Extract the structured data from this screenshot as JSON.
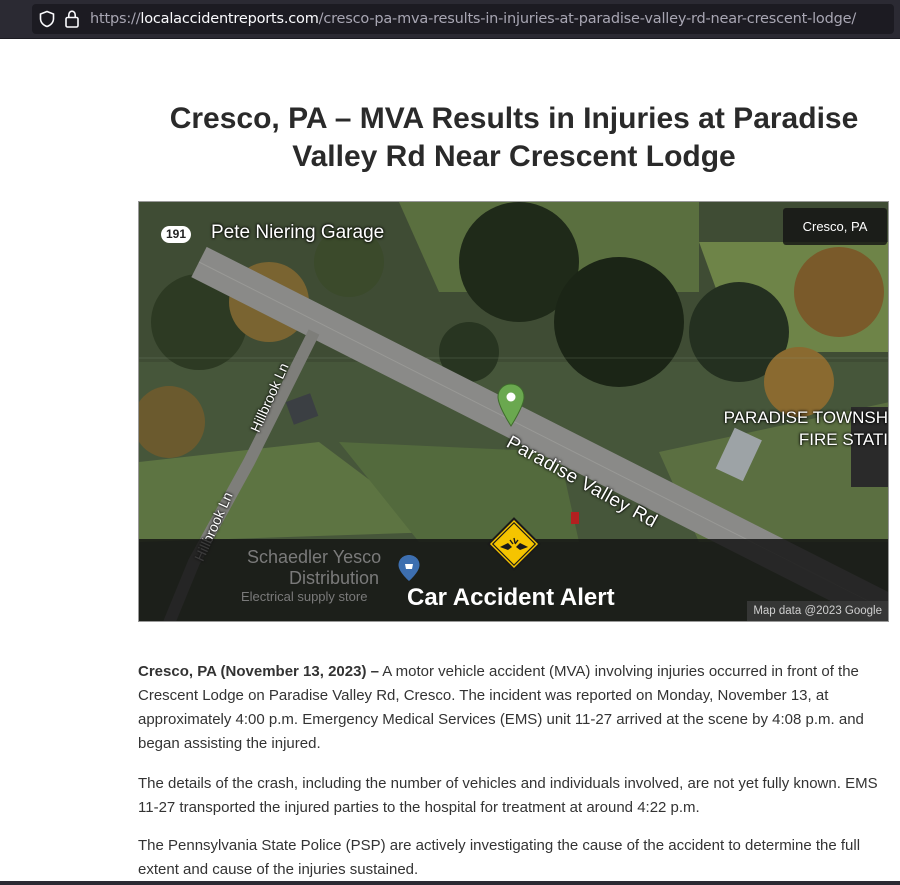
{
  "browser": {
    "url_protocol": "https://",
    "url_host": "localaccidentreports.com",
    "url_path": "/cresco-pa-mva-results-in-injuries-at-paradise-valley-rd-near-crescent-lodge/"
  },
  "article": {
    "title": "Cresco, PA – MVA Results in Injuries at Paradise Valley Rd Near Crescent Lodge",
    "p1_lead": "Cresco, PA (November 13, 2023) –",
    "p1_body": " A motor vehicle accident (MVA) involving injuries occurred in front of the Crescent Lodge on Paradise Valley Rd, Cresco. The incident was reported on Monday, November 13, at approximately 4:00 p.m. Emergency Medical Services (EMS) unit 11-27 arrived at the scene by 4:08 p.m. and began assisting the injured.",
    "p2": "The details of the crash, including the number of vehicles and individuals involved, are not yet fully known. EMS 11-27 transported the injured parties to the hospital for treatment at around 4:22 p.m.",
    "p3": "The Pennsylvania State Police (PSP) are actively investigating the cause of the accident to determine the full extent and cause of the injuries sustained."
  },
  "map": {
    "route_number": "191",
    "poi_garage": "Pete Niering Garage",
    "location_chip": "Cresco, PA",
    "road_paradise": "Paradise Valley Rd",
    "road_hillbrook_1": "Hillbrook Ln",
    "road_hillbrook_2": "Hillbrook Ln",
    "poi_fire_line1": "PARADISE TOWNSH",
    "poi_fire_line2": "FIRE STATI",
    "poi_store_line1": "Schaedler Yesco",
    "poi_store_line2": "Distribution",
    "poi_store_line3": "Electrical supply store",
    "alert_label": "Car Accident Alert",
    "attribution": "Map data @2023 Google",
    "pin_color": "#6aa84f",
    "alert_color": "#f5c400"
  }
}
